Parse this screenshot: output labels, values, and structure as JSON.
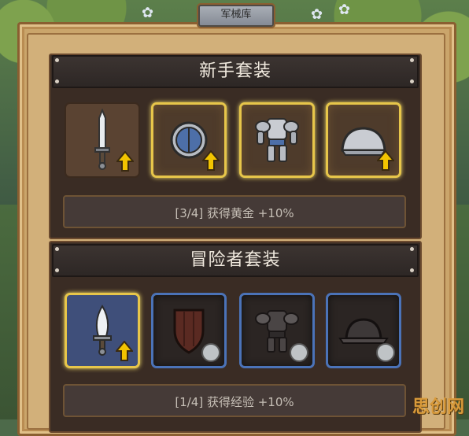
{
  "window": {
    "title": "军械库"
  },
  "sets": [
    {
      "name": "新手套装",
      "bonus": "[3/4] 获得黄金 +10%"
    },
    {
      "name": "冒险者套装",
      "bonus": "[1/4] 获得经验 +10%"
    }
  ],
  "watermark": "思创网",
  "colors": {
    "gold_frame": "#e7c64a",
    "blue_frame": "#4b73b8",
    "upgrade_arrow": "#f2c400"
  },
  "icons": {
    "set1": [
      "sword-icon",
      "round-shield-icon",
      "armor-icon",
      "helmet-icon"
    ],
    "set2": [
      "dagger-icon",
      "kite-shield-icon",
      "dark-armor-icon",
      "dark-helmet-icon"
    ]
  }
}
